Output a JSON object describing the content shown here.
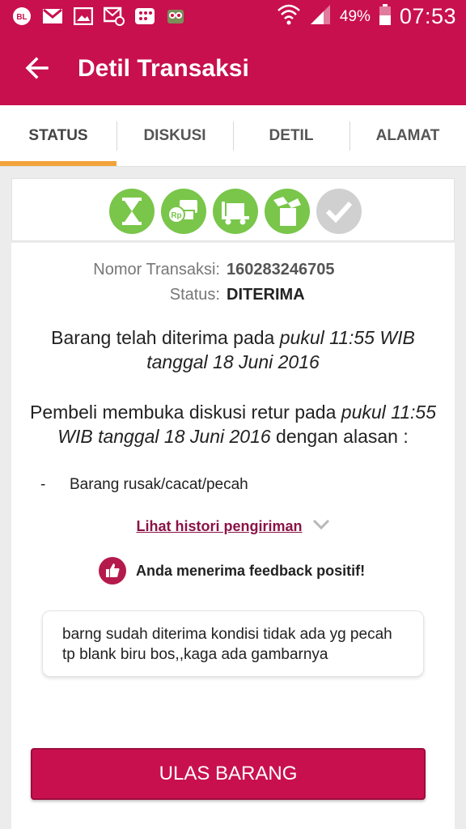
{
  "statusbar": {
    "icons": [
      "bbm-icon",
      "gmail-icon",
      "gallery-icon",
      "message-icon",
      "blackberry-icon",
      "owl-icon"
    ],
    "battery": "49%",
    "time": "07:53"
  },
  "appbar": {
    "title": "Detil Transaksi"
  },
  "tabs": [
    {
      "label": "STATUS",
      "active": true
    },
    {
      "label": "DISKUSI",
      "active": false
    },
    {
      "label": "DETIL",
      "active": false
    },
    {
      "label": "ALAMAT",
      "active": false
    }
  ],
  "steps": [
    {
      "icon": "hourglass-icon",
      "done": true
    },
    {
      "icon": "payment-icon",
      "done": true
    },
    {
      "icon": "truck-icon",
      "done": true
    },
    {
      "icon": "package-received-icon",
      "done": true
    },
    {
      "icon": "check-icon",
      "done": false
    }
  ],
  "transaction": {
    "number_label": "Nomor Transaksi:",
    "number_value": "160283246705",
    "status_label": "Status:",
    "status_value": "DITERIMA"
  },
  "message1": {
    "text": "Barang telah diterima pada ",
    "time": "pukul 11:55 WIB tanggal 18 Juni 2016"
  },
  "message2": {
    "text": "Pembeli membuka diskusi retur pada ",
    "time": "pukul 11:55 WIB tanggal 18 Juni 2016",
    "suffix": " dengan alasan :"
  },
  "reason": {
    "dash": "-",
    "text": "Barang rusak/cacat/pecah"
  },
  "history_link": "Lihat histori pengiriman",
  "feedback": {
    "text": "Anda menerima feedback positif!",
    "comment": "barng sudah diterima kondisi tidak ada yg pecah tp blank biru bos,,kaga ada gambarnya"
  },
  "review_button": "ULAS BARANG",
  "colors": {
    "primary": "#c8104e",
    "tab_indicator": "#f2a33a",
    "step_done": "#79c64a",
    "step_pending": "#d0d0d0"
  }
}
